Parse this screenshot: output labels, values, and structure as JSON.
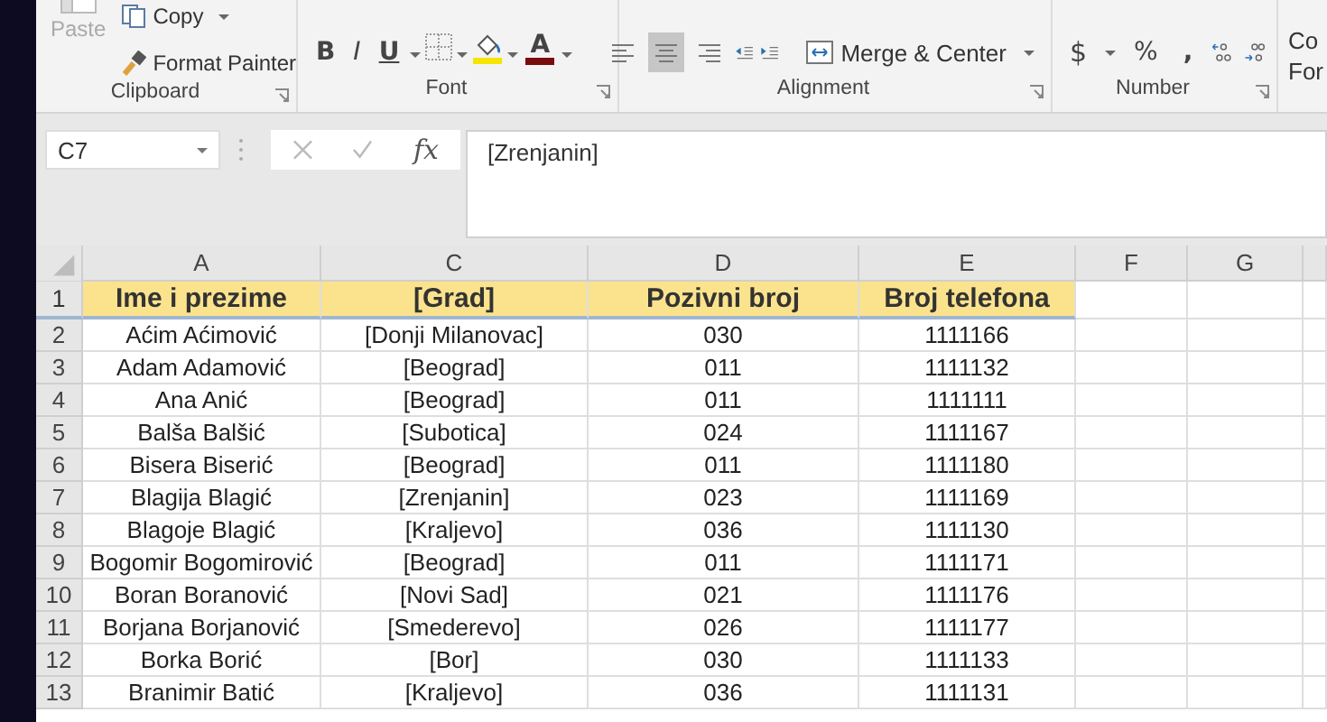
{
  "ribbon": {
    "clipboard": {
      "paste": "Paste",
      "copy": "Copy",
      "format_painter": "Format Painter",
      "label": "Clipboard"
    },
    "font": {
      "bold": "B",
      "italic": "I",
      "underline": "U",
      "font_color": "A",
      "label": "Font"
    },
    "alignment": {
      "buttons": [
        {
          "kind": "left",
          "selected": false
        },
        {
          "kind": "center",
          "selected": true
        },
        {
          "kind": "right",
          "selected": false
        }
      ],
      "merge_center": "Merge & Center",
      "label": "Alignment"
    },
    "number": {
      "currency": "$",
      "percent": "%",
      "comma": ",",
      "label": "Number"
    },
    "styles": {
      "line_1": "Co",
      "line_2": "For"
    }
  },
  "formula_bar": {
    "name_box": "C7",
    "function_label": "fx",
    "formula": "[Zrenjanin]"
  },
  "sheet": {
    "columns": [
      "A",
      "C",
      "D",
      "E",
      "F",
      "G"
    ],
    "rows": [
      {
        "number": "1",
        "kind": "header",
        "cells": [
          "Ime i prezime",
          "[Grad]",
          "Pozivni broj",
          "Broj telefona"
        ]
      },
      {
        "number": "2",
        "kind": "data",
        "cells": [
          "Aćim Aćimović",
          "[Donji Milanovac]",
          "030",
          "1111166"
        ]
      },
      {
        "number": "3",
        "kind": "data",
        "cells": [
          "Adam Adamović",
          "[Beograd]",
          "011",
          "1111132"
        ]
      },
      {
        "number": "4",
        "kind": "data",
        "cells": [
          "Ana Anić",
          "[Beograd]",
          "011",
          "1111111"
        ]
      },
      {
        "number": "5",
        "kind": "data",
        "cells": [
          "Balša Balšić",
          "[Subotica]",
          "024",
          "1111167"
        ]
      },
      {
        "number": "6",
        "kind": "data",
        "cells": [
          "Bisera Biserić",
          "[Beograd]",
          "011",
          "1111180"
        ]
      },
      {
        "number": "7",
        "kind": "data",
        "cells": [
          "Blagija Blagić",
          "[Zrenjanin]",
          "023",
          "1111169"
        ]
      },
      {
        "number": "8",
        "kind": "data",
        "cells": [
          "Blagoje Blagić",
          "[Kraljevo]",
          "036",
          "1111130"
        ]
      },
      {
        "number": "9",
        "kind": "data",
        "cells": [
          "Bogomir Bogomirović",
          "[Beograd]",
          "011",
          "1111171"
        ]
      },
      {
        "number": "10",
        "kind": "data",
        "cells": [
          "Boran Boranović",
          "[Novi Sad]",
          "021",
          "1111176"
        ]
      },
      {
        "number": "11",
        "kind": "data",
        "cells": [
          "Borjana Borjanović",
          "[Smederevo]",
          "026",
          "1111177"
        ]
      },
      {
        "number": "12",
        "kind": "data",
        "cells": [
          "Borka Borić",
          "[Bor]",
          "030",
          "1111133"
        ]
      },
      {
        "number": "13",
        "kind": "data",
        "cells": [
          "Branimir Batić",
          "[Kraljevo]",
          "036",
          "1111131"
        ]
      }
    ]
  }
}
